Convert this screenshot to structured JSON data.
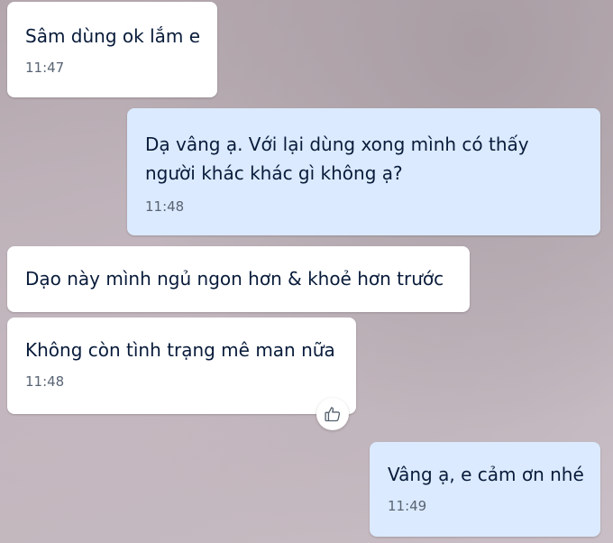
{
  "messages": [
    {
      "direction": "incoming",
      "text": "Sâm dùng ok lắm e",
      "time": "11:47"
    },
    {
      "direction": "outgoing",
      "text": "Dạ vâng ạ. Với lại dùng xong mình có thấy người khác khác gì không ạ?",
      "time": "11:48"
    },
    {
      "direction": "incoming",
      "text": "Dạo này mình ngủ ngon hơn & khoẻ hơn trước",
      "time": ""
    },
    {
      "direction": "incoming",
      "text": "Không còn tình trạng mê man nữa",
      "time": "11:48",
      "reaction": "thumbs-up-icon"
    },
    {
      "direction": "outgoing",
      "text": "Vâng ạ, e cảm ơn nhé",
      "time": "11:49"
    }
  ],
  "colors": {
    "incoming_bubble": "#ffffff",
    "outgoing_bubble": "#dbeafe",
    "text": "#081b3a",
    "timestamp": "#596474"
  }
}
